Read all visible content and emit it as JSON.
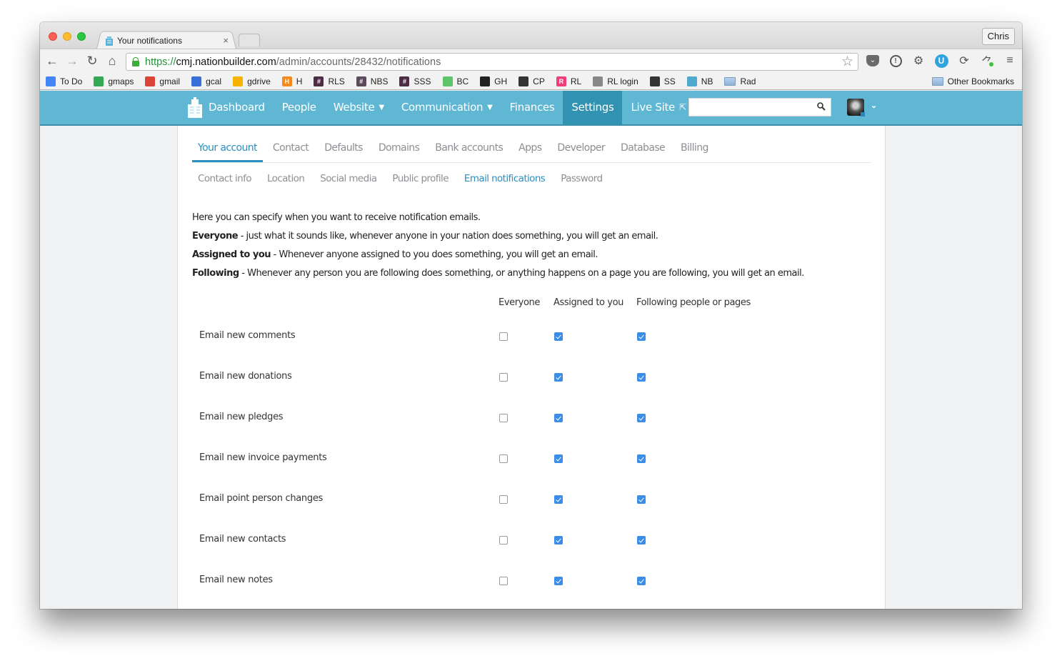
{
  "browser": {
    "tab_title": "Your notifications",
    "profile_name": "Chris",
    "url": {
      "scheme": "https://",
      "host": "cmj.nationbuilder.com",
      "path": "/admin/accounts/28432/notifications"
    },
    "bookmarks": [
      {
        "label": "To Do",
        "icon": "google-docs-icon",
        "color": "#4285f4"
      },
      {
        "label": "gmaps",
        "icon": "google-maps-icon",
        "color": "#34a853"
      },
      {
        "label": "gmail",
        "icon": "gmail-icon",
        "color": "#db4437"
      },
      {
        "label": "gcal",
        "icon": "google-calendar-icon",
        "color": "#3a6fd8"
      },
      {
        "label": "gdrive",
        "icon": "google-drive-icon",
        "color": "#f4b400"
      },
      {
        "label": "H",
        "icon": "h-icon",
        "color": "#f48a1f"
      },
      {
        "label": "RLS",
        "icon": "slack-hash-icon",
        "color": "#4d2d46"
      },
      {
        "label": "NBS",
        "icon": "slack-hash-icon",
        "color": "#5c4a5c"
      },
      {
        "label": "SSS",
        "icon": "slack-hash-icon",
        "color": "#4d2d46"
      },
      {
        "label": "BC",
        "icon": "basecamp-icon",
        "color": "#5ec46b"
      },
      {
        "label": "GH",
        "icon": "github-icon",
        "color": "#222222"
      },
      {
        "label": "CP",
        "icon": "codepen-icon",
        "color": "#333333"
      },
      {
        "label": "RL",
        "icon": "r-icon",
        "color": "#f03e79"
      },
      {
        "label": "RL login",
        "icon": "wordpress-icon",
        "color": "#888888"
      },
      {
        "label": "SS",
        "icon": "squarespace-icon",
        "color": "#333333"
      },
      {
        "label": "NB",
        "icon": "nationbuilder-icon",
        "color": "#4fa9cf"
      },
      {
        "label": "Rad",
        "icon": "folder-icon",
        "color": "#9cc0e4"
      }
    ],
    "other_bookmarks": "Other Bookmarks"
  },
  "nav": {
    "items": [
      {
        "label": "Dashboard",
        "dropdown": false,
        "active": false
      },
      {
        "label": "People",
        "dropdown": false,
        "active": false
      },
      {
        "label": "Website",
        "dropdown": true,
        "active": false
      },
      {
        "label": "Communication",
        "dropdown": true,
        "active": false
      },
      {
        "label": "Finances",
        "dropdown": false,
        "active": false
      },
      {
        "label": "Settings",
        "dropdown": false,
        "active": true
      },
      {
        "label": "Live Site",
        "dropdown": false,
        "active": false
      }
    ],
    "search_value": "",
    "colors": {
      "bar": "#5fb7d4",
      "active": "#3192b1"
    }
  },
  "settings_tabs": [
    {
      "label": "Your account",
      "active": true
    },
    {
      "label": "Contact",
      "active": false
    },
    {
      "label": "Defaults",
      "active": false
    },
    {
      "label": "Domains",
      "active": false
    },
    {
      "label": "Bank accounts",
      "active": false
    },
    {
      "label": "Apps",
      "active": false
    },
    {
      "label": "Developer",
      "active": false
    },
    {
      "label": "Database",
      "active": false
    },
    {
      "label": "Billing",
      "active": false
    }
  ],
  "account_tabs": [
    {
      "label": "Contact info",
      "active": false
    },
    {
      "label": "Location",
      "active": false
    },
    {
      "label": "Social media",
      "active": false
    },
    {
      "label": "Public profile",
      "active": false
    },
    {
      "label": "Email notifications",
      "active": true
    },
    {
      "label": "Password",
      "active": false
    }
  ],
  "description": {
    "intro": "Here you can specify when you want to receive notification emails.",
    "lines": [
      {
        "term": "Everyone",
        "text": " - just what it sounds like, whenever anyone in your nation does something, you will get an email."
      },
      {
        "term": "Assigned to you",
        "text": " - Whenever anyone assigned to you does something, you will get an email."
      },
      {
        "term": "Following",
        "text": " - Whenever any person you are following does something, or anything happens on a page you are following, you will get an email."
      }
    ]
  },
  "notifications": {
    "columns": [
      "Everyone",
      "Assigned to you",
      "Following people or pages"
    ],
    "rows": [
      {
        "label": "Email new comments",
        "everyone": false,
        "assigned": true,
        "following": true
      },
      {
        "label": "Email new donations",
        "everyone": false,
        "assigned": true,
        "following": true
      },
      {
        "label": "Email new pledges",
        "everyone": false,
        "assigned": true,
        "following": true
      },
      {
        "label": "Email new invoice payments",
        "everyone": false,
        "assigned": true,
        "following": true
      },
      {
        "label": "Email point person changes",
        "everyone": false,
        "assigned": true,
        "following": true
      },
      {
        "label": "Email new contacts",
        "everyone": false,
        "assigned": true,
        "following": true
      },
      {
        "label": "Email new notes",
        "everyone": false,
        "assigned": true,
        "following": true
      }
    ],
    "checkbox_color": "#3b8de6"
  }
}
